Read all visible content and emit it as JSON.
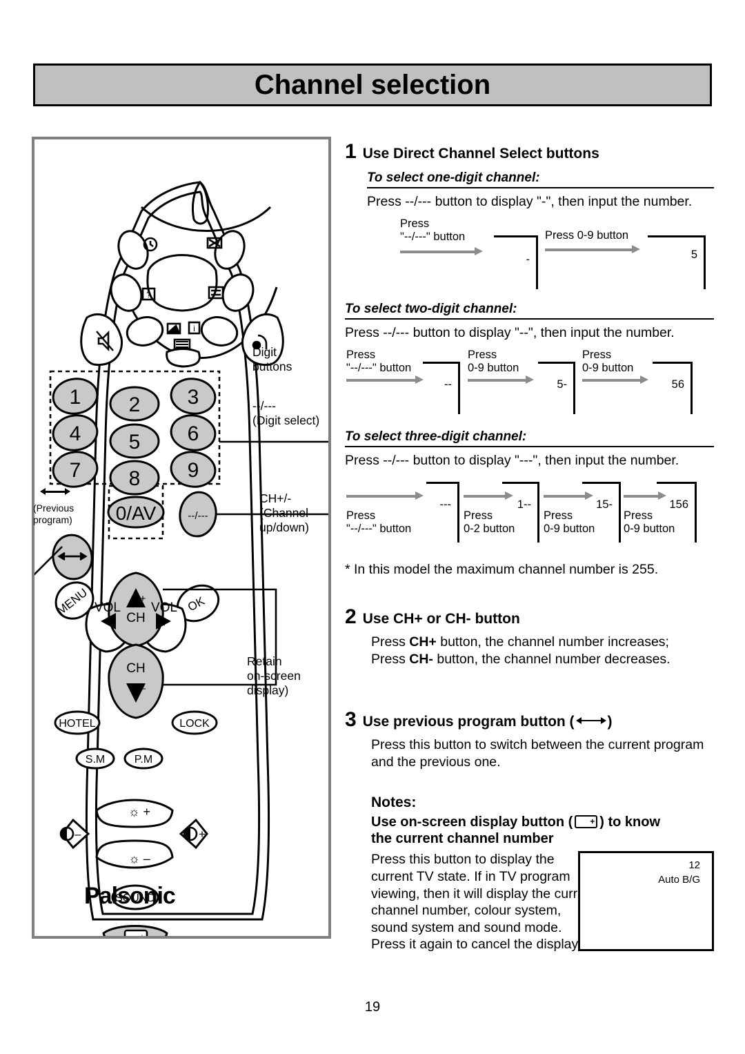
{
  "header": {
    "title": "Channel selection"
  },
  "page_number": "19",
  "remote": {
    "brand": "Palsonic",
    "digit_buttons": [
      "1",
      "2",
      "3",
      "4",
      "5",
      "6",
      "7",
      "8",
      "9"
    ],
    "zero_button": "0/AV",
    "digit_select_button": "--/---",
    "nav": {
      "menu": "MENU",
      "ok": "OK",
      "vol_label": "VOL",
      "ch_label": "CH"
    },
    "small_buttons": {
      "hotel": "HOTEL",
      "lock": "LOCK",
      "sm": "S.M",
      "pm": "P.M",
      "sound": "SOUND"
    },
    "picture_controls": {
      "bright_plus": "+",
      "bright_minus": "–",
      "contrast_plus": "+",
      "contrast_minus": "–"
    },
    "callouts": {
      "digit_buttons": "Digit\nbuttons",
      "digit_select": "--/---\n(Digit select)",
      "ch_updown": "CH+/-\n(Channel\nup/down)",
      "previous_program": "(Previous\nprogram)",
      "retain_osd": "Retain\non-screen\ndisplay)"
    }
  },
  "steps": [
    {
      "num": "1",
      "title": "Use Direct Channel Select buttons",
      "subsections": [
        {
          "heading": "To select one-digit channel:",
          "intro": "Press --/--- button to display \"-\", then input the number.",
          "flow": [
            {
              "label": "Press\n\"--/---\" button",
              "display": "-"
            },
            {
              "label": "Press 0-9 button",
              "display": "5"
            }
          ]
        },
        {
          "heading": "To select two-digit channel:",
          "intro": "Press --/--- button to display \"--\", then input the number.",
          "flow": [
            {
              "label": "Press\n\"--/---\" button",
              "display": "--"
            },
            {
              "label": "Press\n0-9 button",
              "display": "5-"
            },
            {
              "label": "Press\n0-9 button",
              "display": "56"
            }
          ]
        },
        {
          "heading": "To select three-digit channel:",
          "intro": "Press --/--- button to display \"---\", then input the number.",
          "flow": [
            {
              "label": "Press\n\"--/---\" button",
              "display": "---"
            },
            {
              "label": "Press\n0-2 button",
              "display": "1--"
            },
            {
              "label": "Press\n0-9 button",
              "display": "15-"
            },
            {
              "label": "Press\n0-9 button",
              "display": "156"
            }
          ]
        }
      ],
      "footnote": "*  In this model the maximum channel number is 255."
    },
    {
      "num": "2",
      "title": "Use CH+ or CH- button",
      "line1_a": "Press ",
      "line1_b": "CH+",
      "line1_c": " button, the channel number increases;",
      "line2_a": "Press ",
      "line2_b": "CH-",
      "line2_c": " button, the channel number decreases."
    },
    {
      "num": "3",
      "title_a": "Use previous program button (",
      "title_b": ")",
      "body": "Press this button to switch between the current program and the previous one."
    }
  ],
  "notes": {
    "title": "Notes:",
    "heading_a": "Use on-screen display button (",
    "heading_b": ") to know",
    "heading_c": "the current channel number",
    "body": "Press this button to display the current TV state. If in TV program viewing, then it will display the current channel number, colour system, sound system and sound mode. Press it again to cancel the display.",
    "tv_display": {
      "channel": "12",
      "system": "Auto B/G"
    }
  },
  "colors": {
    "banner_bg": "#c0c0c0",
    "box_border": "#808080",
    "arrow_gray": "#8c8c8c",
    "button_fill": "#c9c9c9"
  }
}
